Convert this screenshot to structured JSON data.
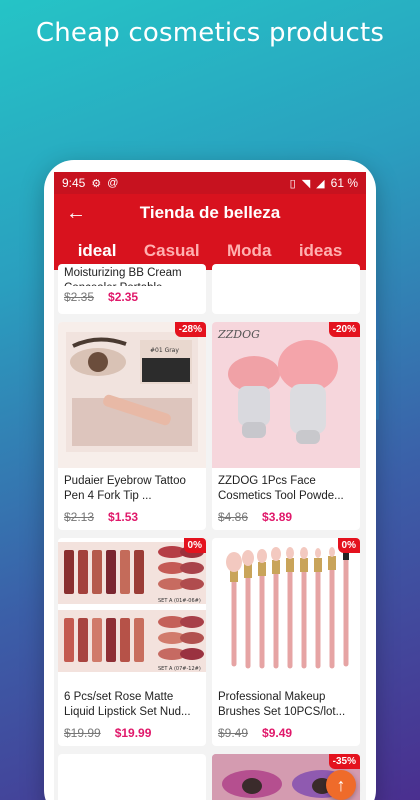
{
  "headline": "Cheap cosmetics products",
  "status": {
    "time": "9:45",
    "battery": "61 %"
  },
  "appbar": {
    "title": "Tienda de belleza"
  },
  "tabs": [
    "ideal",
    "Casual",
    "Moda",
    "ideas"
  ],
  "products": [
    {
      "name": "Moisturizing BB Cream Concealer Portable ...",
      "old_price": "$2.35",
      "price": "$2.35"
    },
    {
      "name": "",
      "old_price": "",
      "price": ""
    },
    {
      "name": "Pudaier Eyebrow Tattoo Pen 4 Fork Tip ...",
      "old_price": "$2.13",
      "price": "$1.53",
      "badge": "-28%",
      "image_text": "#01 Gray"
    },
    {
      "name": "ZZDOG 1Pcs Face Cosmetics Tool Powde...",
      "old_price": "$4.86",
      "price": "$3.89",
      "badge": "-20%",
      "image_text": "ZZDOG"
    },
    {
      "name": "6 Pcs/set Rose Matte Liquid Lipstick Set Nud...",
      "old_price": "$19.99",
      "price": "$19.99",
      "badge": "0%",
      "image_text_a": "SET A (01#-06#)",
      "image_text_b": "SET A (07#-12#)"
    },
    {
      "name": "Professional Makeup Brushes Set 10PCS/lot...",
      "old_price": "$9.49",
      "price": "$9.49",
      "badge": "0%"
    },
    {
      "badge": "-35%"
    }
  ],
  "colors": {
    "accent": "#d8121e",
    "price": "#e0186a",
    "fab": "#ef6b2a"
  }
}
